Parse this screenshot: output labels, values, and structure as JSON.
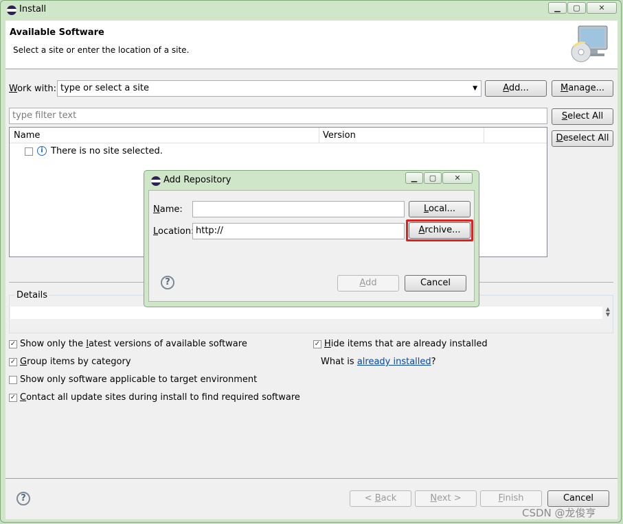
{
  "window": {
    "title": "Install"
  },
  "banner": {
    "title": "Available Software",
    "subtitle": "Select a site or enter the location of a site."
  },
  "work_with": {
    "label_pre": "",
    "label_mnemonic": "W",
    "label_post": "ork with:",
    "value": "type or select a site"
  },
  "buttons": {
    "add": {
      "mn": "A",
      "rest": "dd..."
    },
    "manage": {
      "mn": "M",
      "rest": "anage..."
    },
    "select_all": {
      "mn": "S",
      "rest": "elect All"
    },
    "deselect_all": {
      "mn": "D",
      "rest": "eselect All"
    }
  },
  "filter": {
    "placeholder": "type filter text"
  },
  "table": {
    "columns": [
      "Name",
      "Version"
    ],
    "rows": [
      {
        "text": "There is no site selected."
      }
    ]
  },
  "details": {
    "label": "Details"
  },
  "options": {
    "latest": {
      "pre": "Show only the ",
      "mn": "l",
      "post": "atest versions of available software"
    },
    "group": {
      "pre": "",
      "mn": "G",
      "post": "roup items by category"
    },
    "applicable": {
      "pre": "Show only software applicable to target environment",
      "mn": "",
      "post": ""
    },
    "contact": {
      "pre": "",
      "mn": "C",
      "post": "ontact all update sites during install to find required software"
    },
    "hide": {
      "pre": "",
      "mn": "H",
      "post": "ide items that are already installed"
    },
    "what_is": {
      "pre": "What is ",
      "link": "already installed",
      "post": "?"
    }
  },
  "wizard": {
    "back": {
      "pre": "< ",
      "mn": "B",
      "post": "ack"
    },
    "next": {
      "pre": "",
      "mn": "N",
      "post": "ext >"
    },
    "finish": {
      "pre": "",
      "mn": "F",
      "post": "inish"
    },
    "cancel": "Cancel"
  },
  "dialog": {
    "title": "Add Repository",
    "name_label": {
      "mn": "N",
      "rest": "ame:"
    },
    "name_value": "",
    "location_label": {
      "mn": "L",
      "rest": "ocation:"
    },
    "location_value": "http://",
    "local": {
      "mn": "L",
      "rest": "ocal..."
    },
    "archive": {
      "mn": "A",
      "rest": "rchive..."
    },
    "add": {
      "mn": "A",
      "rest": "dd"
    },
    "cancel": "Cancel"
  },
  "watermark": "CSDN @龙俊亨",
  "colors": {
    "highlight_border": "#e0201c",
    "link": "#0645ad",
    "window_frame": "#cfe6c8"
  }
}
